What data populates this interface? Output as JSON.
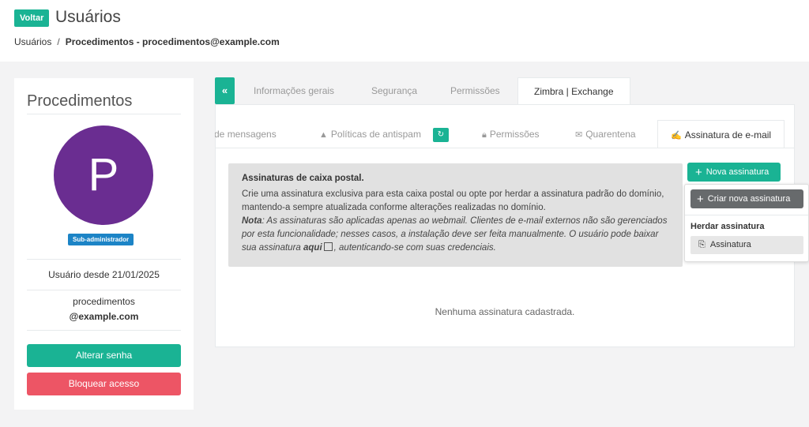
{
  "header": {
    "back_label": "Voltar",
    "title": "Usuários",
    "breadcrumb": {
      "root": "Usuários",
      "separator": "/",
      "current": "Procedimentos - procedimentos@example.com"
    }
  },
  "profile": {
    "name": "Procedimentos",
    "avatar_letter": "P",
    "avatar_color": "#6a2d91",
    "role_badge": "Sub-administrador",
    "since": "Usuário desde 21/01/2025",
    "login": "procedimentos",
    "domain": "@example.com",
    "change_password_label": "Alterar senha",
    "block_access_label": "Bloquear acesso"
  },
  "tabs": {
    "collapse_icon": "«",
    "items": [
      {
        "label": "Informações gerais"
      },
      {
        "label": "Segurança"
      },
      {
        "label": "Permissões"
      },
      {
        "label": "Zimbra | Exchange"
      }
    ],
    "active": "Zimbra | Exchange"
  },
  "subtabs": {
    "items": [
      {
        "label": "o de mensagens",
        "icon": ""
      },
      {
        "label": "Políticas de antispam",
        "icon": "warning-icon"
      },
      {
        "label": "Permissões",
        "icon": "lock-icon"
      },
      {
        "label": "Quarentena",
        "icon": "envelope-icon"
      },
      {
        "label": "Assinatura de e-mail",
        "icon": "signature-icon"
      }
    ],
    "active": "Assinatura de e-mail"
  },
  "info": {
    "title": "Assinaturas de caixa postal.",
    "body": "Crie uma assinatura exclusiva para esta caixa postal ou opte por herdar a assinatura padrão do domínio, mantendo-a sempre atualizada conforme alterações realizadas no domínio.",
    "note_label": "Nota",
    "note_text": ": As assinaturas são aplicadas apenas ao webmail. Clientes de e-mail externos não são gerenciados por esta funcionalidade; nesses casos, a instalação deve ser feita manualmente. O usuário pode baixar sua assinatura ",
    "note_link": "aqui",
    "note_end": ", autenticando-se com suas credenciais."
  },
  "actions": {
    "new_signature": "Nova assinatura",
    "create_new": "Criar nova assinatura",
    "inherit_header": "Herdar assinatura",
    "inherit_item": "Assinatura"
  },
  "empty_message": "Nenhuma assinatura cadastrada.",
  "colors": {
    "accent": "#1ab394",
    "danger": "#ed5565",
    "badge": "#1c84c6"
  }
}
